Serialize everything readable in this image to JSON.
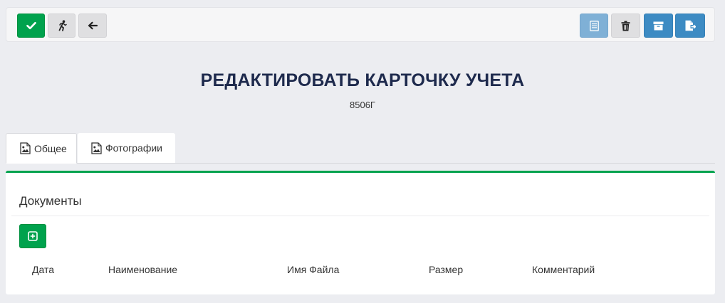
{
  "toolbar": {
    "left_buttons": [
      {
        "icon": "check-icon",
        "color": "#00a24d"
      },
      {
        "icon": "running-man-icon",
        "color": "#dfdfe1"
      },
      {
        "icon": "arrow-left-icon",
        "color": "#dfdfe1"
      }
    ],
    "right_buttons": [
      {
        "icon": "list-icon",
        "color": "#7fb0d6"
      },
      {
        "icon": "trash-icon",
        "color": "#dfdfe1"
      },
      {
        "icon": "archive-icon",
        "color": "#3d8bc3"
      },
      {
        "icon": "file-export-icon",
        "color": "#3d8bc3"
      }
    ]
  },
  "header": {
    "title": "РЕДАКТИРОВАТЬ КАРТОЧКУ УЧЕТА",
    "subtitle": "8506Г"
  },
  "tabs": [
    {
      "label": "Общее",
      "icon": "image-icon",
      "active": true
    },
    {
      "label": "Фотографии",
      "icon": "image-icon",
      "active": false
    }
  ],
  "documents": {
    "title": "Документы",
    "add_button_icon": "plus-square-icon",
    "columns": [
      "Дата",
      "Наименование",
      "Имя Файла",
      "Размер",
      "Комментарий"
    ],
    "rows": []
  },
  "colors": {
    "accent_green": "#00a24d",
    "accent_blue": "#3d8bc3",
    "title_color": "#1e2a4d",
    "background": "#ecedf1"
  }
}
